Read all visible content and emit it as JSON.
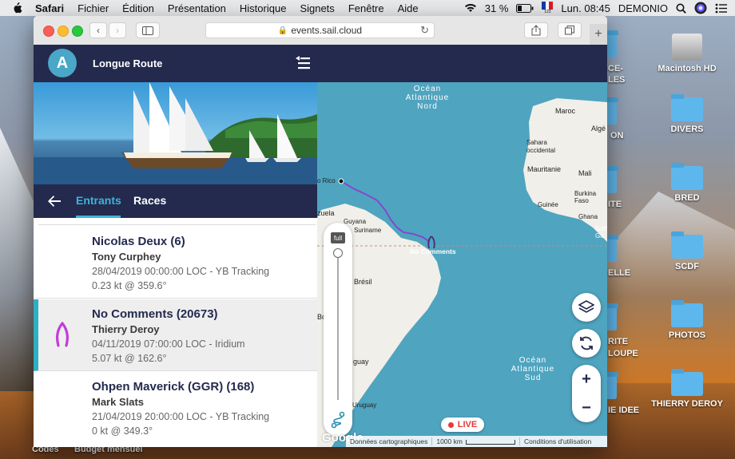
{
  "menubar": {
    "items": [
      "Safari",
      "Fichier",
      "Édition",
      "Présentation",
      "Historique",
      "Signets",
      "Fenêtre",
      "Aide"
    ],
    "battery": "31 %",
    "flag_sub": "123",
    "clock": "Lun. 08:45",
    "user": "DEMONIO"
  },
  "desktop": {
    "icons": [
      {
        "label": "Macintosh HD",
        "icon": "hard-drive-icon"
      },
      {
        "label": "DIVERS",
        "icon": "folder-icon"
      },
      {
        "label": "BRED",
        "icon": "folder-icon"
      },
      {
        "label": "SCDF",
        "icon": "folder-icon"
      },
      {
        "label": "PHOTOS",
        "icon": "folder-icon"
      },
      {
        "label": "THIERRY DEROY",
        "icon": "folder-icon"
      }
    ],
    "partial_labels": [
      "CE-",
      "LES",
      "ON",
      "ITE",
      "ELLE",
      "RITE",
      "LOUPE",
      "IE IDEE"
    ],
    "bottom_labels": [
      "Codes",
      "Budget mensuel"
    ]
  },
  "browser": {
    "url": "events.sail.cloud"
  },
  "app": {
    "title": "Longue Route",
    "logo_letter": "A",
    "tabs": {
      "entrants": "Entrants",
      "races": "Races"
    },
    "entries": [
      {
        "name": "Nicolas Deux (6)",
        "skipper": "Tony Curphey",
        "position": "28/04/2019 00:00:00 LOC - YB Tracking",
        "speed": "0.23 kt @ 359.6°"
      },
      {
        "name": "No Comments (20673)",
        "skipper": "Thierry Deroy",
        "position": "04/11/2019 07:00:00 LOC - Iridium",
        "speed": "5.07 kt @ 162.6°"
      },
      {
        "name": "Ohpen Maverick (GGR) (168)",
        "skipper": "Mark Slats",
        "position": "21/04/2019 20:00:00 LOC - YB Tracking",
        "speed": "0 kt @ 349.3°"
      }
    ],
    "accent_color": "#3fb3d8",
    "track_color": "#8a3fd1"
  },
  "map": {
    "oceans": [
      "Océan Atlantique Nord",
      "Océan Atlantique Sud"
    ],
    "countries": [
      "Maroc",
      "Algé",
      "Sahara occidental",
      "Mauritanie",
      "Mali",
      "Burkina Faso",
      "Guinée",
      "Ghana",
      "Golf Gu",
      "Brésil",
      "Guyana",
      "Suriname",
      "zuela",
      "Bo",
      "guay",
      "Uruguay",
      "o Rico"
    ],
    "boat_label": "No Comments",
    "slider_label": "full",
    "live_label": "LIVE",
    "attribution": "Données cartographiques",
    "scale": "1000 km",
    "terms": "Conditions d'utilisation",
    "google": "Google"
  }
}
